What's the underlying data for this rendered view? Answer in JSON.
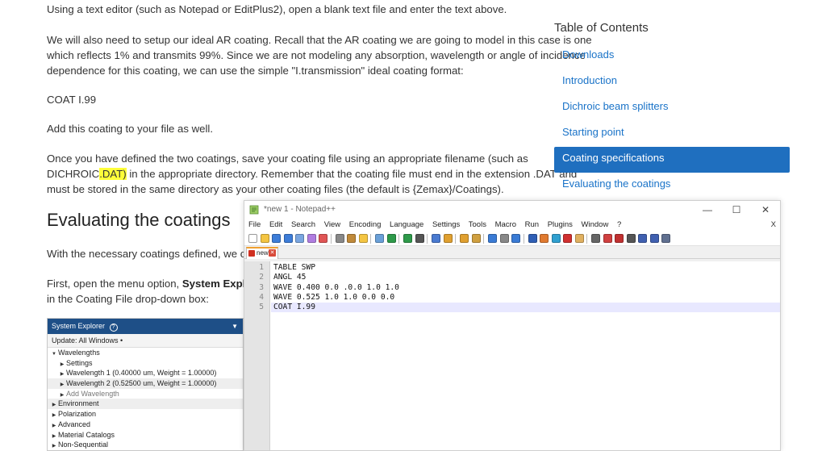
{
  "article": {
    "p1": "Using a text editor (such as Notepad or EditPlus2), open a blank text file and enter the text above.",
    "p2_l1": "We will also need to setup our ideal AR coating. Recall that the AR coating we are going to model in this case is one",
    "p2_l2": "which reflects 1% and transmits 99%. Since we are not modeling any absorption, wavelength or angle of incidence",
    "p2_l3": "dependence for this coating, we can use the simple \"I.transmission\" ideal coating format:",
    "code_line": "COAT I.99",
    "p3": "Add this coating to your file as well.",
    "p4_l1": "Once you have defined the two coatings, save your coating file using an appropriate filename (such as",
    "p4_l2_a": "DICHROIC",
    "p4_l2_hl": ".DAT)",
    "p4_l2_b": " in the appropriate directory. Remember that the coating file must end in the extension .DAT and",
    "p4_l3": "must be stored in the same directory as your other coating files (the default is {Zemax}/Coatings).",
    "heading": "Evaluating the coatings",
    "p5": "With the necessary coatings defined, we can n",
    "p6_a": "First, open the menu option, ",
    "p6_bold": "System Explorer.",
    "p6_l2": "in the Coating File drop-down box:"
  },
  "toc": {
    "title": "Table of Contents",
    "items": [
      {
        "label": "Downloads"
      },
      {
        "label": "Introduction"
      },
      {
        "label": "Dichroic beam splitters"
      },
      {
        "label": "Starting point"
      },
      {
        "label": "Coating specifications"
      },
      {
        "label": "Evaluating the coatings"
      }
    ],
    "active_index": 4
  },
  "system_explorer": {
    "title": "System Explorer",
    "help_glyph": "?",
    "update": "Update: All Windows •",
    "rows": [
      {
        "label": "Wavelengths",
        "level": 0,
        "arrow": "down"
      },
      {
        "label": "Settings",
        "level": 1,
        "arrow": "right"
      },
      {
        "label": "Wavelength 1 (0.40000 um, Weight = 1.00000)",
        "level": 1,
        "arrow": "right"
      },
      {
        "label": "Wavelength 2 (0.52500 um, Weight = 1.00000)",
        "level": 1,
        "arrow": "right"
      },
      {
        "label": "Add Wavelength",
        "level": 1,
        "arrow": "right",
        "dim": true
      },
      {
        "label": "Environment",
        "level": 0,
        "arrow": "right"
      },
      {
        "label": "Polarization",
        "level": 0,
        "arrow": "right"
      },
      {
        "label": "Advanced",
        "level": 0,
        "arrow": "right"
      },
      {
        "label": "Material Catalogs",
        "level": 0,
        "arrow": "right"
      },
      {
        "label": "Non-Sequential",
        "level": 0,
        "arrow": "right"
      }
    ]
  },
  "notepad": {
    "title": "*new 1 - Notepad++",
    "menu": [
      "File",
      "Edit",
      "Search",
      "View",
      "Encoding",
      "Language",
      "Settings",
      "Tools",
      "Macro",
      "Run",
      "Plugins",
      "Window",
      "?"
    ],
    "menu_close": "X",
    "tab_label": "new 1",
    "lines": [
      {
        "num": "1",
        "text": "TABLE SWP"
      },
      {
        "num": "2",
        "text": "ANGL 45"
      },
      {
        "num": "3",
        "text": "WAVE 0.400 0.0 .0.0 1.0 1.0"
      },
      {
        "num": "4",
        "text": "WAVE 0.525 1.0 1.0 0.0 0.0"
      },
      {
        "num": "5",
        "text": "COAT I.99"
      }
    ],
    "current_line": 5,
    "colors": {
      "accent": "#1f6fbf",
      "current_line": "#e8e8ff"
    }
  }
}
